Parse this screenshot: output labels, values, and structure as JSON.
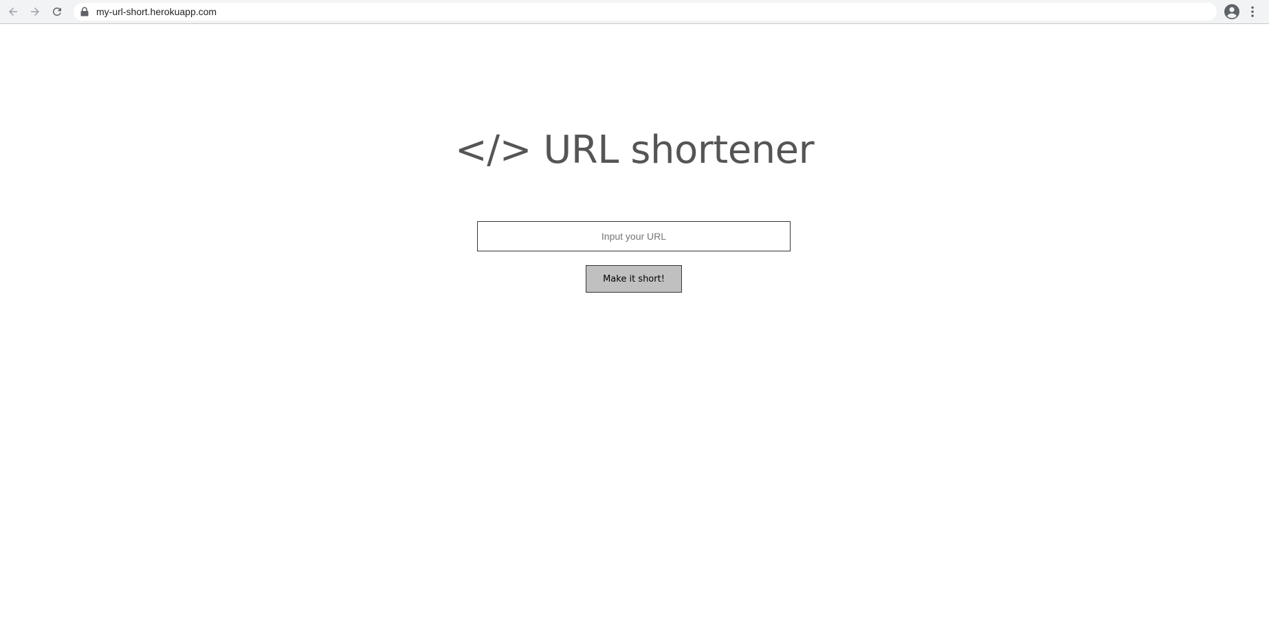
{
  "browser": {
    "url": "my-url-short.herokuapp.com",
    "icons": {
      "back": "arrow-left-icon",
      "forward": "arrow-right-icon",
      "reload": "reload-icon",
      "lock": "lock-icon",
      "bookmark": "star-icon",
      "profile": "account-circle-icon",
      "menu": "kebab-menu-icon"
    }
  },
  "page": {
    "title": "</> URL shortener",
    "input": {
      "placeholder": "Input your URL",
      "value": ""
    },
    "submit_label": "Make it short!"
  },
  "colors": {
    "title": "#555555",
    "button_bg": "#c0c0c0",
    "border": "#333333"
  }
}
